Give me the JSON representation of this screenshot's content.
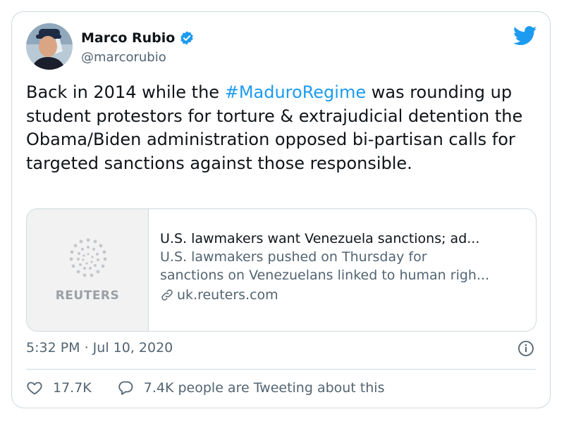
{
  "tweet": {
    "author_name": "Marco Rubio",
    "handle": "@marcorubio",
    "text_before": "Back in 2014 while the ",
    "hashtag": "#MaduroRegime",
    "text_after": " was rounding up student protestors for torture & extrajudicial detention the Obama/Biden administration opposed bi-partisan calls for targeted sanctions against those responsible.",
    "timestamp": "5:32 PM · Jul 10, 2020"
  },
  "link_card": {
    "logo_text": "REUTERS",
    "title": "U.S. lawmakers want Venezuela sanctions; ad...",
    "description_line1": "U.S. lawmakers pushed on Thursday for",
    "description_line2": "sanctions on Venezuelans linked to human righ...",
    "domain": "uk.reuters.com"
  },
  "actions": {
    "likes": "17.7K",
    "replies_text": "7.4K people are Tweeting about this"
  },
  "icons": {
    "verified": "verified-badge-icon",
    "brand": "twitter-bird-icon",
    "link": "link-chain-icon",
    "info": "info-icon",
    "like": "heart-icon",
    "reply": "reply-bubble-icon"
  },
  "colors": {
    "accent": "#1d9bf0",
    "text": "#0f1419",
    "secondary": "#536471",
    "border": "#cfd9de"
  }
}
